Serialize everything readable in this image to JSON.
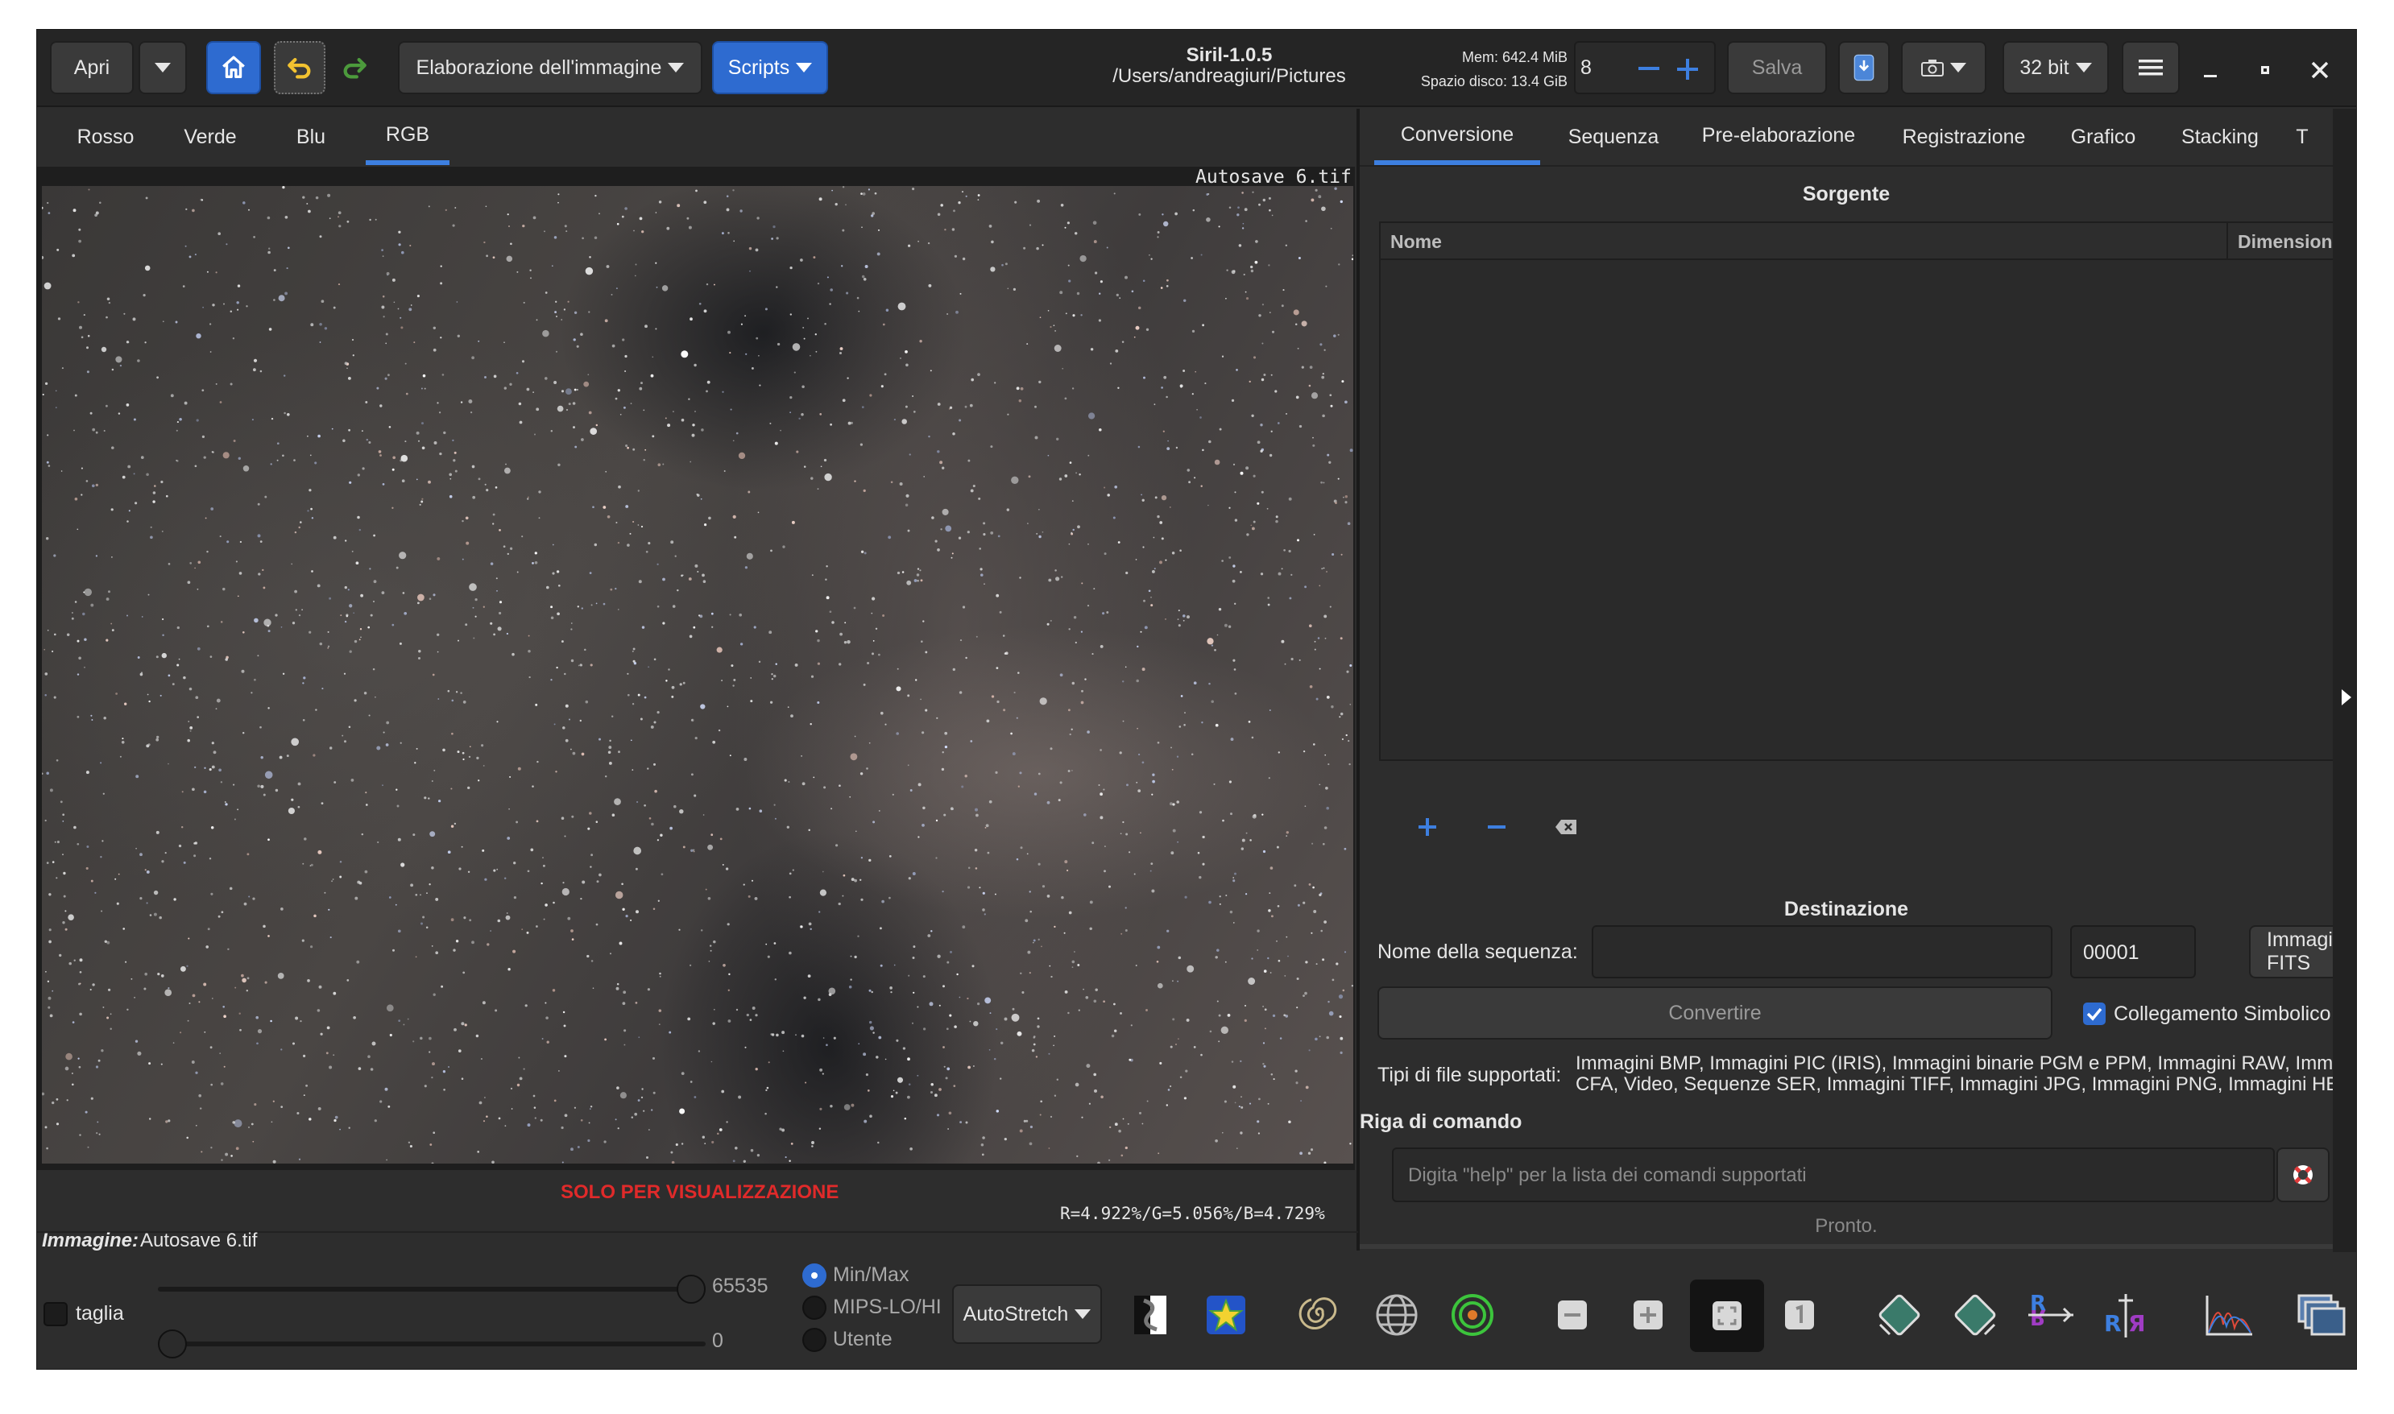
{
  "header": {
    "open_label": "Apri",
    "processing_menu": "Elaborazione dell'immagine",
    "scripts_menu": "Scripts",
    "app_title": "Siril-1.0.5",
    "working_dir": "/Users/andreagiuri/Pictures",
    "mem": "Mem: 642.4 MiB",
    "disk": "Spazio disco: 13.4 GiB",
    "threads": "8",
    "save_label": "Salva",
    "bitdepth": "32 bit"
  },
  "channels": {
    "tabs": [
      "Rosso",
      "Verde",
      "Blu",
      "RGB"
    ],
    "active": "RGB"
  },
  "image": {
    "filename_overlay": "Autosave 6.tif",
    "display_only": "SOLO PER VISUALIZZAZIONE",
    "rgb_readout": "R=4.922%/G=5.056%/B=4.729%"
  },
  "panel": {
    "tabs": [
      "Conversione",
      "Sequenza",
      "Pre-elaborazione",
      "Registrazione",
      "Grafico",
      "Stacking",
      "T"
    ],
    "active_tab": "Conversione",
    "source_title": "Sorgente",
    "col_name": "Nome",
    "col_dim": "Dimensioni",
    "dest_title": "Destinazione",
    "seq_name_label": "Nome della sequenza:",
    "seq_index": "00001",
    "output_type": "Immagini FITS",
    "convert_label": "Convertire",
    "symlink_label": "Collegamento Simbolico",
    "symlink_checked": true,
    "supported_label": "Tipi di file supportati:",
    "supported_line1": "Immagini BMP, Immagini PIC (IRIS), Immagini binarie PGM e PPM, Immagini RAW, Immagini",
    "supported_line2": "CFA, Video, Sequenze SER, Immagini TIFF, Immagini JPG, Immagini PNG, Immagini HEIF"
  },
  "console": {
    "title": "Riga di comando",
    "placeholder": "Digita \"help\" per la lista dei comandi supportati",
    "status": "Pronto."
  },
  "bottom": {
    "image_label": "Immagine:",
    "image_name": "Autosave 6.tif",
    "crop_label": "taglia",
    "hi_value": "65535",
    "lo_value": "0",
    "hi_slider": 1.0,
    "lo_slider": 0.0,
    "modes": [
      "Min/Max",
      "MIPS-LO/HI",
      "Utente"
    ],
    "selected_mode": "Min/Max",
    "stretch": "AutoStretch"
  },
  "colors": {
    "accent": "#2e6bd0",
    "warning_text": "#e02a2a",
    "background": "#2d2d2d"
  }
}
